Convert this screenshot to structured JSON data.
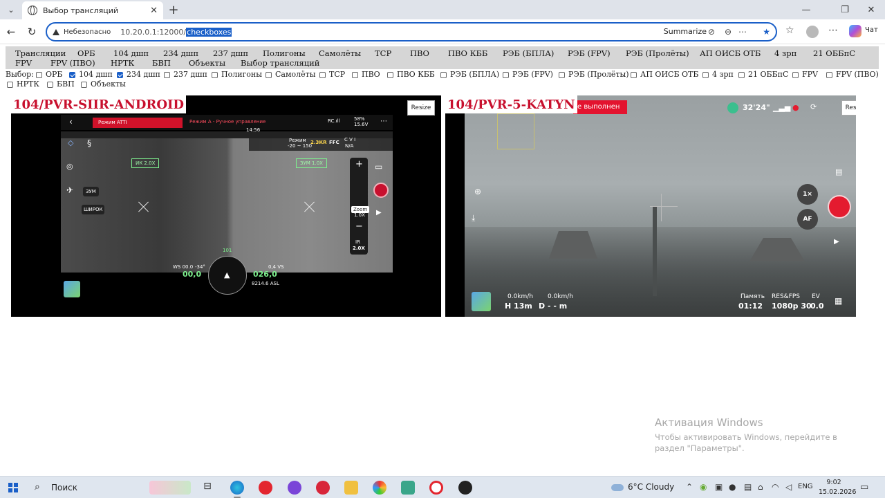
{
  "browser": {
    "tab_title": "Выбор трансляций",
    "tab_close": "✕",
    "new_tab": "+",
    "insecure_label": "Небезопасно",
    "url_base": "10.20.0.1:12000/",
    "url_selected": "checkboxes",
    "summarize_label": "Summarize",
    "chat_label": "Чат"
  },
  "nav": {
    "row1": [
      "Трансляции",
      "ОРБ",
      "104 дшп",
      "234 дшп",
      "237 дшп",
      "Полигоны",
      "Самолёты",
      "ТСР",
      "ПВО",
      "ПВО КББ",
      "РЭБ (БПЛА)",
      "РЭБ (FPV)",
      "РЭБ (Пролёты)",
      "АП ОИСБ ОТБ",
      "4 зрп",
      "21 ОББпС"
    ],
    "row2": [
      "FPV",
      "FPV (ПВО)",
      "НРТК",
      "БВП",
      "Объекты",
      "Выбор трансляций"
    ]
  },
  "selection": {
    "label": "Выбор:",
    "options": [
      {
        "label": "ОРБ",
        "checked": false
      },
      {
        "label": "104 дшп",
        "checked": true
      },
      {
        "label": "234 дшп",
        "checked": true
      },
      {
        "label": "237 дшп",
        "checked": false
      },
      {
        "label": "Полигоны",
        "checked": false
      },
      {
        "label": "Самолёты",
        "checked": false
      },
      {
        "label": "ТСР",
        "checked": false
      },
      {
        "label": "ПВО",
        "checked": false
      },
      {
        "label": "ПВО КББ",
        "checked": false
      },
      {
        "label": "РЭБ (БПЛА)",
        "checked": false
      },
      {
        "label": "РЭБ (FPV)",
        "checked": false
      },
      {
        "label": "РЭБ (Пролёты)",
        "checked": false
      },
      {
        "label": "АП ОИСБ ОТБ",
        "checked": false
      },
      {
        "label": "4 зрп",
        "checked": false
      },
      {
        "label": "21 ОББпС",
        "checked": false
      },
      {
        "label": "FPV",
        "checked": false
      },
      {
        "label": "FPV (ПВО)",
        "checked": false
      },
      {
        "label": "НРТК",
        "checked": false
      },
      {
        "label": "БВП",
        "checked": false
      },
      {
        "label": "Объекты",
        "checked": false
      }
    ]
  },
  "streams": [
    {
      "title": "104/PVR-SIIR-ANDROID",
      "resize_label": "Resize",
      "mode_label": "Режим ATTI",
      "mode_b": "Режим А - Ручное управление",
      "time": "14:56",
      "rc_label": "RC.ıll",
      "battery": "58%",
      "voltage": "15.6V",
      "zoom_ik": "ИК 2.0X",
      "zoom_zum": "ЗУМ 1.0X",
      "zum_btn": "ЗУМ",
      "wide_btn": "ШИРОК",
      "zoom_label": "Zoom",
      "zoom_value": "1.0X",
      "ir_label": "IR",
      "ir_value": "2.0X",
      "ffc": "FFC",
      "zoom_mode": "2.3КR",
      "range_label": "Режим",
      "range_value": "-20 ~ 150",
      "cv_label": "C V I",
      "na_label": "N/A",
      "speed_label": "WS 00.0",
      "heading_deg": "-34°",
      "speed_value": "00,0",
      "alt_value": "026,0",
      "vs_label": "0,4 VS",
      "asl_label": "8214.6 ASL",
      "compass_top": "101"
    },
    {
      "title": "104/PVR-5-KATYN",
      "resize_label": "Resize",
      "status_text": "е выполнен",
      "gps_text": "32'24\"",
      "zoom_btn": "1×",
      "af_btn": "AF",
      "hspeed": "0.0km/h",
      "vspeed": "0.0km/h",
      "height": "H 13m",
      "distance": "D - - m",
      "memory_label": "Память",
      "resfps_label": "RES&FPS",
      "ev_label": "EV",
      "rec_time": "01:12",
      "res_value": "1080p 30",
      "ev_value": "0.0"
    }
  ],
  "watermark": {
    "title": "Активация Windows",
    "text": "Чтобы активировать Windows, перейдите в раздел \"Параметры\"."
  },
  "taskbar": {
    "search_label": "Поиск",
    "weather": "6°C  Cloudy",
    "lang": "ENG",
    "time": "9:02",
    "date": "15.02.2026"
  }
}
